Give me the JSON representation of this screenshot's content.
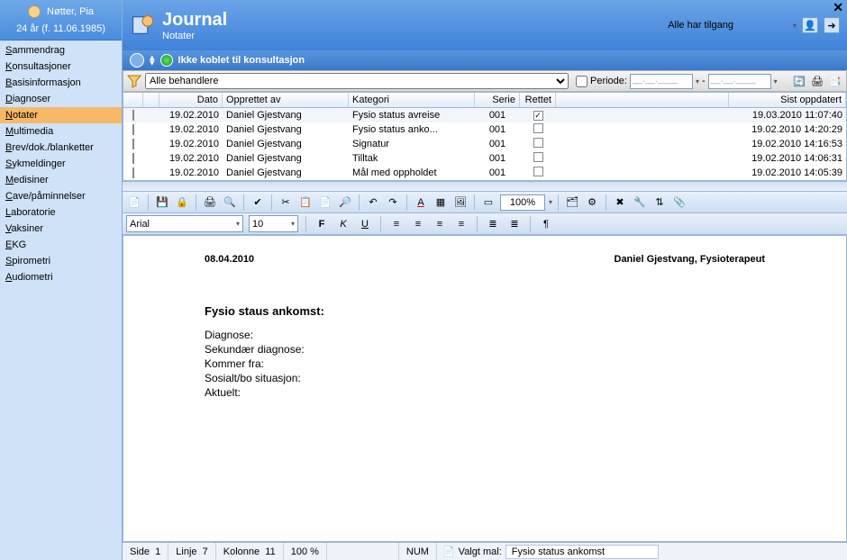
{
  "patient": {
    "name": "Nøtter, Pia",
    "age_line": "24 år (f. 11.06.1985)"
  },
  "nav": {
    "items": [
      "Sammendrag",
      "Konsultasjoner",
      "Basisinformasjon",
      "Diagnoser",
      "Notater",
      "Multimedia",
      "Brev/dok./blanketter",
      "Sykmeldinger",
      "Medisiner",
      "Cave/påminnelser",
      "Laboratorie",
      "Vaksiner",
      "EKG",
      "Spirometri",
      "Audiometri"
    ],
    "selected": "Notater"
  },
  "header": {
    "title": "Journal",
    "subtitle": "Notater",
    "access": "Alle har tilgang"
  },
  "subbar": {
    "label": "Ikke koblet til konsultasjon"
  },
  "filter": {
    "behandler": "Alle behandlere",
    "periode_label": "Periode:",
    "date_from": "__.__.____",
    "date_to": "__.__.____"
  },
  "grid": {
    "headers": {
      "dato": "Dato",
      "opprettet": "Opprettet av",
      "kategori": "Kategori",
      "serie": "Serie",
      "rettet": "Rettet",
      "sist": "Sist oppdatert"
    },
    "rows": [
      {
        "dato": "19.02.2010",
        "opprettet": "Daniel Gjestvang",
        "kategori": "Fysio status avreise",
        "serie": "001",
        "rettet": true,
        "sist": "19.03.2010 11:07:40"
      },
      {
        "dato": "19.02.2010",
        "opprettet": "Daniel Gjestvang",
        "kategori": "Fysio status anko...",
        "serie": "001",
        "rettet": false,
        "sist": "19.02.2010 14:20:29"
      },
      {
        "dato": "19.02.2010",
        "opprettet": "Daniel Gjestvang",
        "kategori": "Signatur",
        "serie": "001",
        "rettet": false,
        "sist": "19.02.2010 14:16:53"
      },
      {
        "dato": "19.02.2010",
        "opprettet": "Daniel Gjestvang",
        "kategori": "Tilltak",
        "serie": "001",
        "rettet": false,
        "sist": "19.02.2010 14:06:31"
      },
      {
        "dato": "19.02.2010",
        "opprettet": "Daniel Gjestvang",
        "kategori": "Mål med oppholdet",
        "serie": "001",
        "rettet": false,
        "sist": "19.02.2010 14:05:39"
      }
    ]
  },
  "editor": {
    "font": "Arial",
    "size": "10",
    "zoom": "100%",
    "date": "08.04.2010",
    "author": "Daniel Gjestvang, Fysioterapeut",
    "section_title": "Fysio staus ankomst:",
    "fields": [
      "Diagnose:",
      "Sekundær diagnose:",
      "Kommer fra:",
      "Sosialt/bo situasjon:",
      "Aktuelt:"
    ]
  },
  "status": {
    "side_lbl": "Side",
    "side_val": "1",
    "linje_lbl": "Linje",
    "linje_val": "7",
    "kol_lbl": "Kolonne",
    "kol_val": "11",
    "zoom": "100 %",
    "num": "NUM",
    "mal_lbl": "Valgt mal:",
    "mal_val": "Fysio status ankomst"
  }
}
